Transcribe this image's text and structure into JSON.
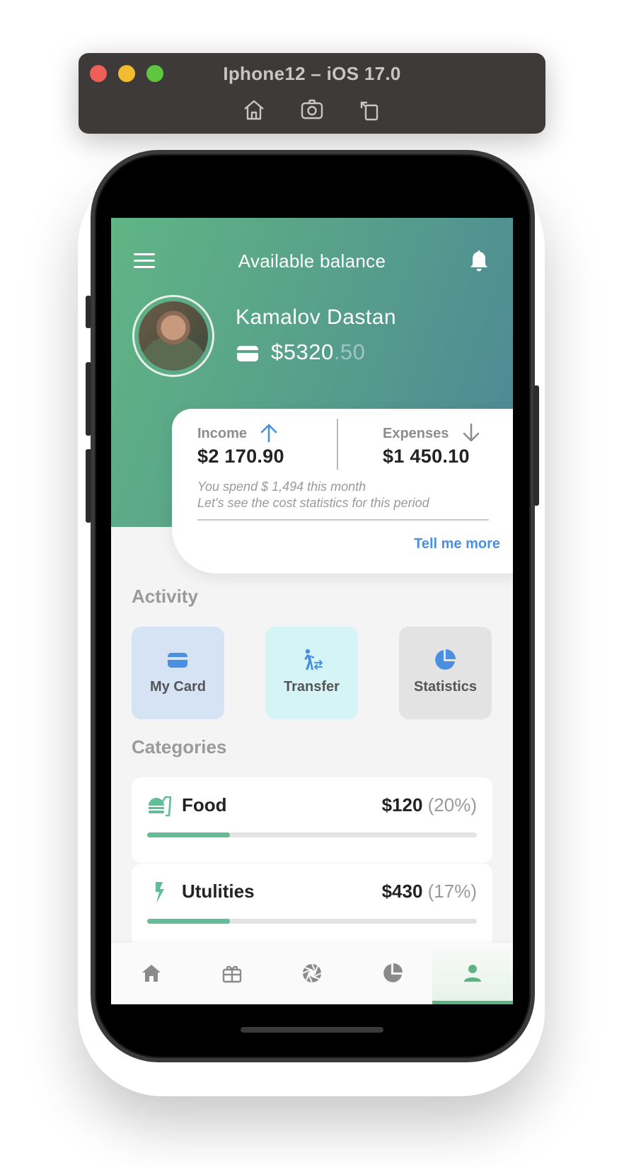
{
  "simulator": {
    "title": "Iphone12 – iOS 17.0",
    "tools": [
      "home-icon",
      "screenshot-icon",
      "rotate-icon"
    ]
  },
  "header": {
    "title": "Available balance",
    "user_name": "Kamalov Dastan",
    "balance_main": "$5320",
    "balance_cents": ".50"
  },
  "summary": {
    "income_label": "Income",
    "income_value": "$2 170.90",
    "expenses_label": "Expenses",
    "expenses_value": "$1 450.10",
    "note_line1": "You spend $ 1,494 this month",
    "note_line2": "Let's see the cost statistics for this period",
    "more_link": "Tell me more"
  },
  "activity": {
    "title": "Activity",
    "items": [
      {
        "label": "My Card",
        "icon": "card-icon"
      },
      {
        "label": "Transfer",
        "icon": "transfer-icon"
      },
      {
        "label": "Statistics",
        "icon": "pie-chart-icon"
      }
    ]
  },
  "categories": {
    "title": "Categories",
    "items": [
      {
        "name": "Food",
        "amount": "$120",
        "percent": "(20%)",
        "icon": "food-icon",
        "progress": 0.25
      },
      {
        "name": "Utulities",
        "amount": "$430",
        "percent": "(17%)",
        "icon": "bolt-icon",
        "progress": 0.25
      }
    ]
  },
  "tabbar": {
    "tabs": [
      "home-icon",
      "gift-icon",
      "aperture-icon",
      "pie-chart-icon",
      "person-icon"
    ],
    "active_index": 4
  },
  "colors": {
    "accent_green": "#62bd97",
    "header_gradient_start": "#60b584",
    "header_gradient_end": "#4c8796",
    "link_blue": "#4a8fe0"
  }
}
